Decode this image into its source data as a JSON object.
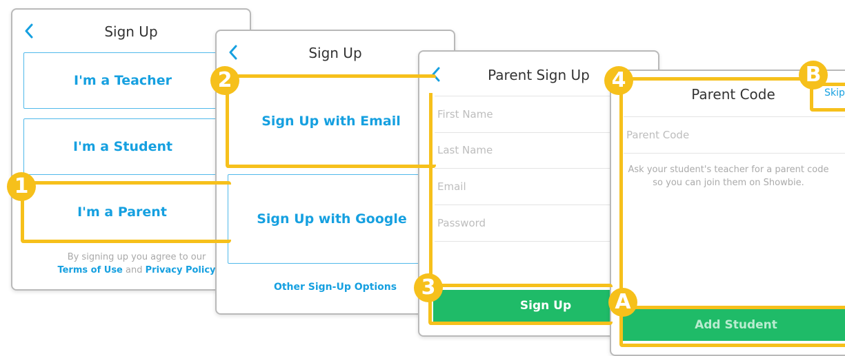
{
  "screen1": {
    "title": "Sign Up",
    "options": [
      "I'm a Teacher",
      "I'm a Student",
      "I'm a Parent"
    ],
    "legal_prefix": "By signing up you agree to our",
    "terms_link": "Terms of Use",
    "legal_and": "and",
    "privacy_link": "Privacy Policy"
  },
  "screen2": {
    "title": "Sign Up",
    "email_button": "Sign Up with Email",
    "google_button": "Sign Up with Google",
    "other_options": "Other Sign-Up Options"
  },
  "screen3": {
    "title": "Parent Sign Up",
    "fields": {
      "first_name_placeholder": "First Name",
      "last_name_placeholder": "Last Name",
      "email_placeholder": "Email",
      "password_placeholder": "Password"
    },
    "submit": "Sign Up"
  },
  "screen4": {
    "title": "Parent Code",
    "skip": "Skip",
    "code_placeholder": "Parent Code",
    "helper": "Ask your student's teacher for a parent code so you can join them on Showbie.",
    "submit": "Add Student"
  },
  "markers": {
    "m1": "1",
    "m2": "2",
    "m3": "3",
    "m4": "4",
    "mA": "A",
    "mB": "B"
  },
  "colors": {
    "accent_blue": "#16a0e0",
    "highlight_yellow": "#f6c01b",
    "button_green": "#1fbb68"
  }
}
